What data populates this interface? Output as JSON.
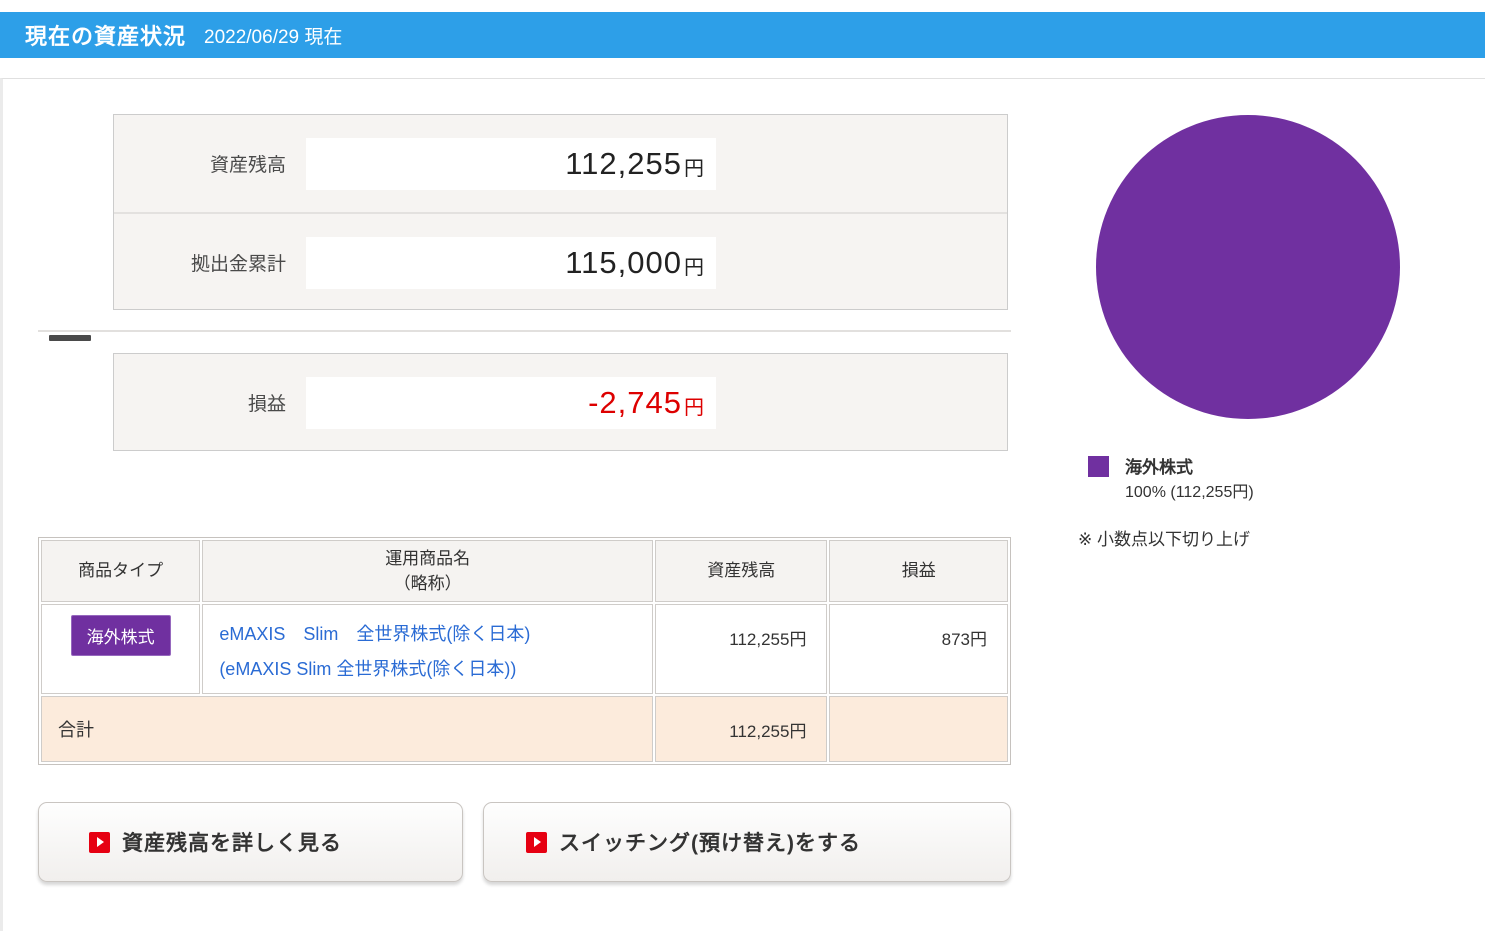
{
  "header": {
    "title": "現在の資産状況",
    "date": "2022/06/29 現在"
  },
  "colors": {
    "accent_blue": "#2D9FE8",
    "purple": "#7030A0",
    "red_icon": "#E60012",
    "negative_red": "#DD0000",
    "link_blue": "#2A6BD4",
    "total_row_bg": "#FCEBDC"
  },
  "summary": {
    "rows": [
      {
        "label": "資産残高",
        "value": "112,255",
        "unit": "円"
      },
      {
        "label": "拠出金累計",
        "value": "115,000",
        "unit": "円"
      }
    ],
    "profit_row": {
      "label": "損益",
      "value": "-2,745",
      "unit": "円"
    }
  },
  "chart_data": {
    "type": "pie",
    "title": "",
    "labels": [
      "海外株式"
    ],
    "values": [
      100
    ],
    "unit": "%",
    "amounts": [
      "112,255円"
    ],
    "colors": [
      "#7030A0"
    ],
    "legend_position": "bottom-left"
  },
  "chart": {
    "legend": {
      "label": "海外株式",
      "detail": "100% (112,255円)"
    },
    "note": "※ 小数点以下切り上げ"
  },
  "table": {
    "headers": {
      "type": "商品タイプ",
      "name_line1": "運用商品名",
      "name_line2": "（略称）",
      "balance": "資産残高",
      "profit": "損益"
    },
    "rows": [
      {
        "type_badge": "海外株式",
        "name_line1": "eMAXIS　Slim　全世界株式(除く日本)",
        "name_line2": "(eMAXIS Slim 全世界株式(除く日本))",
        "balance": "112,255円",
        "profit": "873円"
      }
    ],
    "total": {
      "label": "合計",
      "balance": "112,255円"
    }
  },
  "buttons": [
    {
      "label": "資産残高を詳しく見る"
    },
    {
      "label": "スイッチング(預け替え)をする"
    }
  ]
}
